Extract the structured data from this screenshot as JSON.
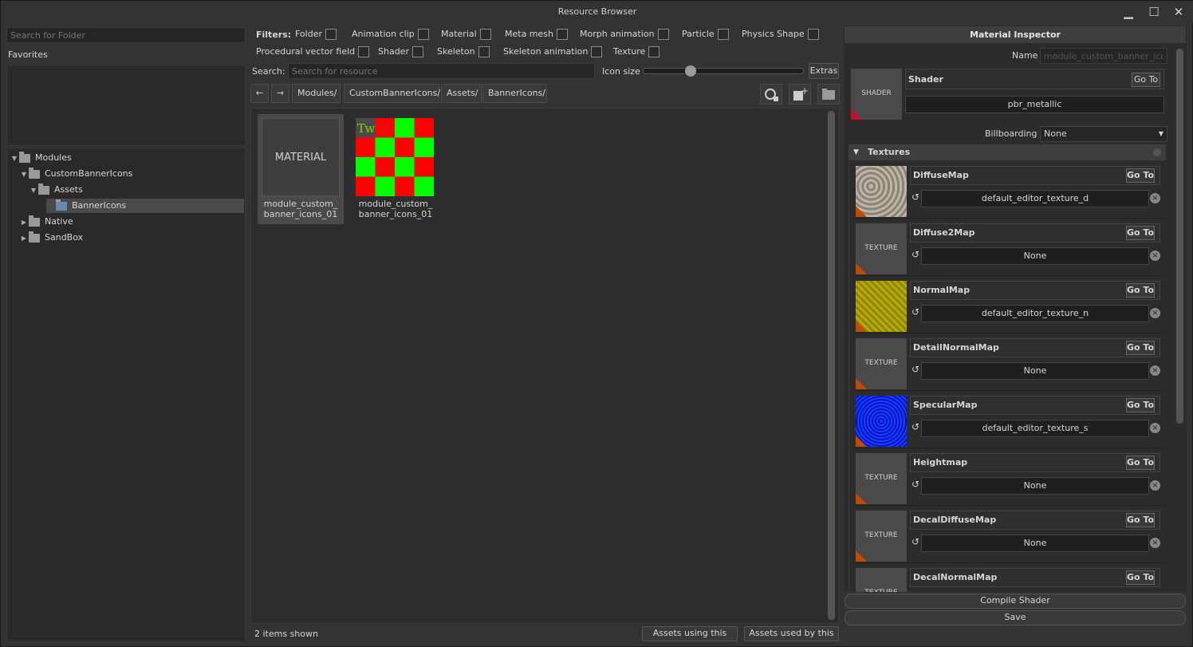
{
  "window": {
    "title": "Resource Browser",
    "minimize": "▁",
    "maximize": "☐",
    "close": "✕"
  },
  "left": {
    "search_placeholder": "Search for Folder",
    "favorites_label": "Favorites",
    "tree": [
      {
        "label": "Modules",
        "expanded": true
      },
      {
        "label": "CustomBannerIcons",
        "expanded": true
      },
      {
        "label": "Assets",
        "expanded": true
      },
      {
        "label": "BannerIcons",
        "selected": true
      },
      {
        "label": "Native",
        "expanded": false
      },
      {
        "label": "SandBox",
        "expanded": false
      }
    ]
  },
  "filters": {
    "label": "Filters:",
    "items": [
      "Folder",
      "Animation clip",
      "Material",
      "Meta mesh",
      "Morph animation",
      "Particle",
      "Physics Shape",
      "Procedural vector field",
      "Shader",
      "Skeleton",
      "Skeleton animation",
      "Texture"
    ]
  },
  "search": {
    "label": "Search:",
    "placeholder": "Search for resource",
    "icon_size_label": "Icon size",
    "icon_size_value": 0.28,
    "extras_label": "Extras"
  },
  "nav": {
    "back": "←",
    "forward": "→",
    "crumbs": [
      "Modules/",
      "CustomBannerIcons/",
      "Assets/",
      "BannerIcons/"
    ]
  },
  "assets": [
    {
      "thumb_text": "MATERIAL",
      "name": "module_custom_banner_icons_01",
      "kind": "material"
    },
    {
      "thumb_text": "TW",
      "name": "module_custom_banner_icons_01",
      "kind": "texture"
    }
  ],
  "status": {
    "count": "2 items shown",
    "using": "Assets using this",
    "used_by": "Assets used by this"
  },
  "inspector": {
    "title": "Material Inspector",
    "name_label": "Name",
    "name_value": "module_custom_banner_icons",
    "shader_thumb": "SHADER",
    "shader_label": "Shader",
    "shader_value": "pbr_metallic",
    "goto": "Go To",
    "billboarding_label": "Billboarding",
    "billboarding_value": "None",
    "textures_label": "Textures",
    "textures": [
      {
        "name": "DiffuseMap",
        "value": "default_editor_texture_d",
        "thumb": "gravel"
      },
      {
        "name": "Diffuse2Map",
        "value": "None",
        "thumb": "TEXTURE"
      },
      {
        "name": "NormalMap",
        "value": "default_editor_texture_n",
        "thumb": "yellow"
      },
      {
        "name": "DetailNormalMap",
        "value": "None",
        "thumb": "TEXTURE"
      },
      {
        "name": "SpecularMap",
        "value": "default_editor_texture_s",
        "thumb": "blue"
      },
      {
        "name": "Heightmap",
        "value": "None",
        "thumb": "TEXTURE"
      },
      {
        "name": "DecalDiffuseMap",
        "value": "None",
        "thumb": "TEXTURE"
      },
      {
        "name": "DecalNormalMap",
        "value": "",
        "thumb": "TEXTURE"
      }
    ],
    "compile": "Compile Shader",
    "save": "Save"
  },
  "colors": {
    "accent": "#c24b00",
    "selection": "#4a4a4a",
    "green": "#00ff00",
    "red": "#ff0000"
  }
}
